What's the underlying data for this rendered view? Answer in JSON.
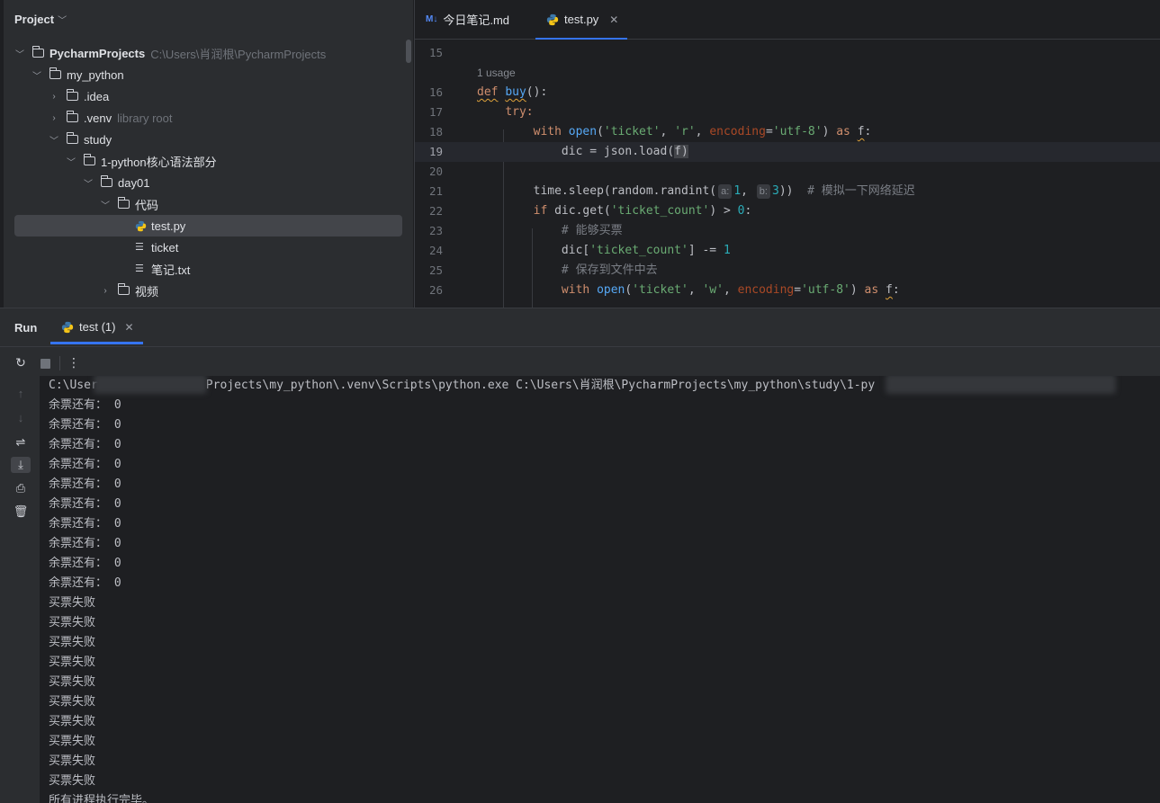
{
  "project": {
    "title": "Project",
    "tree": [
      {
        "label": "PycharmProjects",
        "hint": "C:\\Users\\肖润根\\PycharmProjects",
        "type": "folder",
        "expanded": true
      },
      {
        "label": "my_python",
        "type": "folder",
        "expanded": true
      },
      {
        "label": ".idea",
        "type": "folder",
        "expanded": false
      },
      {
        "label": ".venv",
        "hint": "library root",
        "type": "folder",
        "expanded": false
      },
      {
        "label": "study",
        "type": "folder",
        "expanded": true
      },
      {
        "label": "1-python核心语法部分",
        "type": "folder",
        "expanded": true
      },
      {
        "label": "day01",
        "type": "folder",
        "expanded": true
      },
      {
        "label": "代码",
        "type": "folder",
        "expanded": true
      },
      {
        "label": "test.py",
        "type": "python",
        "selected": true
      },
      {
        "label": "ticket",
        "type": "text"
      },
      {
        "label": "笔记.txt",
        "type": "text"
      },
      {
        "label": "视频",
        "type": "folder",
        "expanded": false
      }
    ]
  },
  "editor": {
    "tabs": [
      {
        "label": "今日笔记.md",
        "badge": "M↓",
        "active": false
      },
      {
        "label": "test.py",
        "active": true
      }
    ],
    "usage_hint": "1 usage",
    "line_numbers": [
      "15",
      "16",
      "17",
      "18",
      "19",
      "20",
      "21",
      "22",
      "23",
      "24",
      "25",
      "26"
    ],
    "current_line": "19",
    "code": {
      "l16_def": "def",
      "l16_name": "buy",
      "l16_rest": "():",
      "l17_try": "try:",
      "l18_with": "with",
      "l18_open": "open",
      "l18_arg1": "'ticket'",
      "l18_arg2": "'r'",
      "l18_kw": "encoding",
      "l18_val": "'utf-8'",
      "l18_as": "as",
      "l18_f": "f",
      "l19": "dic = json.load(",
      "l19_f": "f",
      "l21_a": "time.sleep(random.randint(",
      "l21_hint_a": "a:",
      "l21_v1": "1",
      "l21_hint_b": "b:",
      "l21_v2": "3",
      "l21_cmt": "# 模拟一下网络延迟",
      "l22_if": "if",
      "l22_mid": "dic.get(",
      "l22_str": "'ticket_count'",
      "l22_gt": ") > ",
      "l22_num": "0",
      "l23_cmt": "# 能够买票",
      "l24_a": "dic[",
      "l24_str": "'ticket_count'",
      "l24_b": "] -= ",
      "l24_num": "1",
      "l25_cmt": "# 保存到文件中去",
      "l26_with": "with",
      "l26_open": "open",
      "l26_arg1": "'ticket'",
      "l26_arg2": "'w'",
      "l26_kw": "encoding",
      "l26_val": "'utf-8'",
      "l26_as": "as",
      "l26_f": "f"
    }
  },
  "run": {
    "title": "Run",
    "tab_label": "test (1)",
    "command_prefix": "C:\\User",
    "command_middle": "Projects\\my_python\\.venv\\Scripts\\python.exe C:\\Users\\肖润根\\PycharmProjects\\my_python\\study\\1-py",
    "output": [
      "余票还有： 0",
      "余票还有： 0",
      "余票还有： 0",
      "余票还有： 0",
      "余票还有： 0",
      "余票还有： 0",
      "余票还有： 0",
      "余票还有： 0",
      "余票还有： 0",
      "余票还有： 0",
      "买票失败",
      "买票失败",
      "买票失败",
      "买票失败",
      "买票失败",
      "买票失败",
      "买票失败",
      "买票失败",
      "买票失败",
      "买票失败",
      "所有进程执行完毕。"
    ]
  }
}
